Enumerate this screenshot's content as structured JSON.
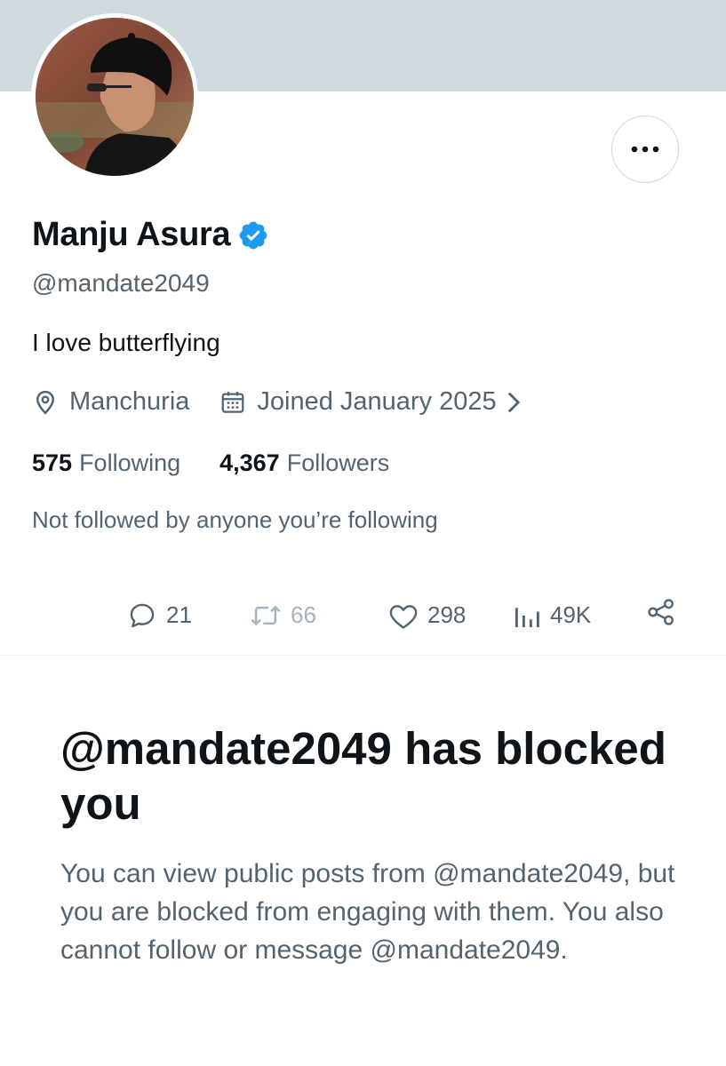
{
  "profile": {
    "display_name": "Manju Asura",
    "handle": "@mandate2049",
    "bio": "I love butterflying",
    "location": "Manchuria",
    "joined": "Joined January 2025",
    "verified": true
  },
  "stats": {
    "following_count": "575",
    "following_label": "Following",
    "followers_count": "4,367",
    "followers_label": "Followers"
  },
  "social_context": "Not followed by anyone you’re following",
  "post_actions": {
    "replies": "21",
    "reposts": "66",
    "likes": "298",
    "views": "49K"
  },
  "blocked": {
    "title": "@mandate2049 has blocked you",
    "description": "You can view public posts from @mandate2049, but you are blocked from engaging with them. You also cannot follow or message @mandate2049."
  },
  "colors": {
    "banner": "#cfd9de",
    "text_primary": "#0f1419",
    "text_secondary": "#536471",
    "verified_blue": "#1d9bf0"
  },
  "icons": {
    "more": "more-horizontal-icon",
    "verified": "verified-badge-icon",
    "location": "location-pin-icon",
    "calendar": "calendar-icon",
    "chevron": "chevron-right-icon",
    "reply": "reply-icon",
    "repost": "repost-icon",
    "like": "heart-icon",
    "views": "views-chart-icon",
    "share": "share-icon"
  }
}
